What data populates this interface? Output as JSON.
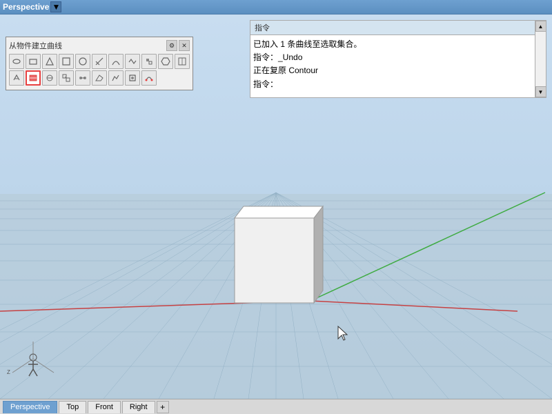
{
  "titleBar": {
    "label": "Perspective"
  },
  "commandPanel": {
    "header": "指令",
    "lines": [
      "已加入 1 条曲线至选取集合。",
      "指令：_Undo",
      "正在复原 Contour",
      "指令："
    ]
  },
  "toolbar": {
    "title": "从物件建立曲线"
  },
  "tabs": [
    {
      "label": "Perspective",
      "active": true
    },
    {
      "label": "Top",
      "active": false
    },
    {
      "label": "Front",
      "active": false
    },
    {
      "label": "Right",
      "active": false
    }
  ],
  "plus_label": "+"
}
